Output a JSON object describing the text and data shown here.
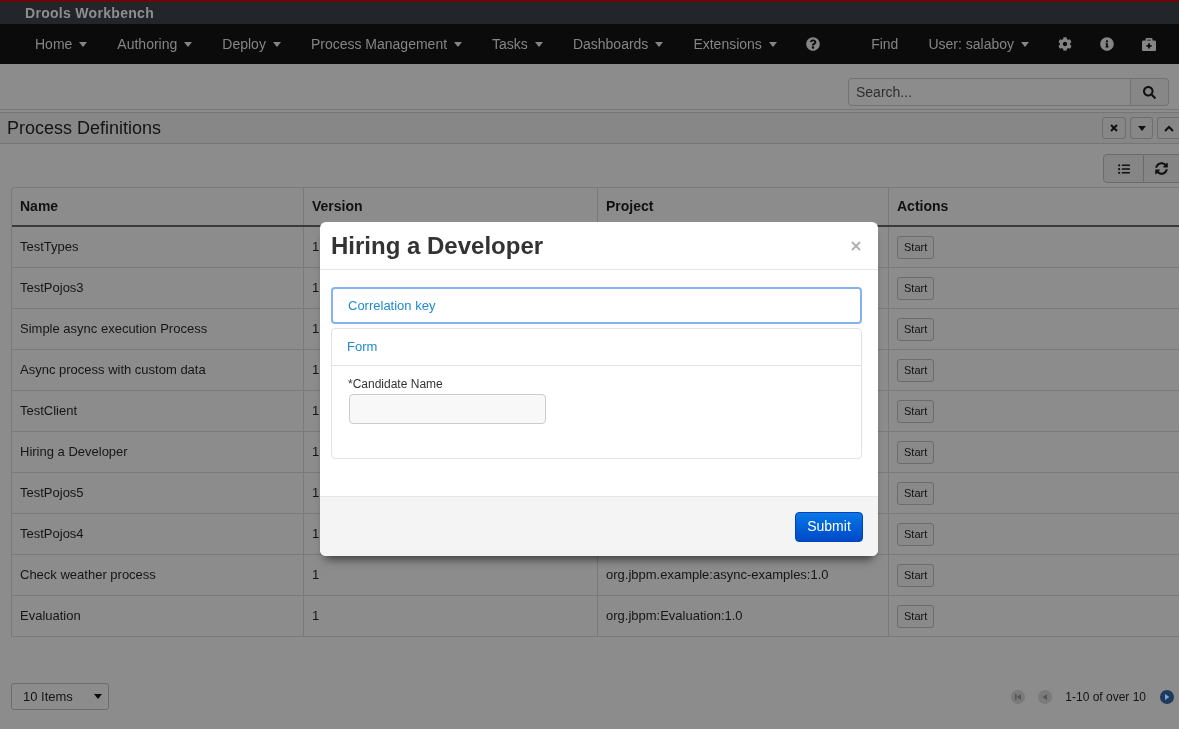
{
  "app": {
    "title": "Drools Workbench"
  },
  "nav": {
    "menus": [
      {
        "label": "Home",
        "dropdown": true
      },
      {
        "label": "Authoring",
        "dropdown": true
      },
      {
        "label": "Deploy",
        "dropdown": true
      },
      {
        "label": "Process Management",
        "dropdown": true
      },
      {
        "label": "Tasks",
        "dropdown": true
      },
      {
        "label": "Dashboards",
        "dropdown": true
      },
      {
        "label": "Extensions",
        "dropdown": true
      }
    ],
    "right_items": [
      {
        "label": "Find",
        "dropdown": false
      },
      {
        "label": "User: salaboy",
        "dropdown": true
      }
    ]
  },
  "search": {
    "placeholder": "Search..."
  },
  "panel": {
    "title": "Process Definitions"
  },
  "table": {
    "columns": [
      "Name",
      "Version",
      "Project",
      "Actions"
    ],
    "rows": [
      {
        "name": "TestTypes",
        "version": "1",
        "action": "Start"
      },
      {
        "name": "TestPojos3",
        "version": "1",
        "action": "Start"
      },
      {
        "name": "Simple async execution Process",
        "version": "1",
        "action": "Start"
      },
      {
        "name": "Async process with custom data",
        "version": "1",
        "action": "Start"
      },
      {
        "name": "TestClient",
        "version": "1",
        "action": "Start"
      },
      {
        "name": "Hiring a Developer",
        "version": "1",
        "action": "Start"
      },
      {
        "name": "TestPojos5",
        "version": "1",
        "action": "Start"
      },
      {
        "name": "TestPojos4",
        "version": "1",
        "action": "Start"
      },
      {
        "name": "Check weather process",
        "version": "1",
        "project": "org.jbpm.example:async-examples:1.0",
        "action": "Start"
      },
      {
        "name": "Evaluation",
        "version": "1",
        "project": "org.jbpm:Evaluation:1.0",
        "action": "Start"
      }
    ]
  },
  "pagination": {
    "page_size": "10 Items",
    "summary": "1-10 of over 10",
    "buttons": [
      {
        "kind": "first",
        "disabled": true
      },
      {
        "kind": "previous",
        "disabled": true
      },
      {
        "kind": "next",
        "disabled": false
      }
    ]
  },
  "modal": {
    "title": "Hiring a Developer",
    "sections": [
      {
        "title": "Correlation key",
        "expanded": false,
        "focused": true
      },
      {
        "title": "Form",
        "expanded": true,
        "focused": false,
        "fields": [
          {
            "label": "*Candidate Name"
          }
        ]
      }
    ],
    "submit": "Submit"
  }
}
